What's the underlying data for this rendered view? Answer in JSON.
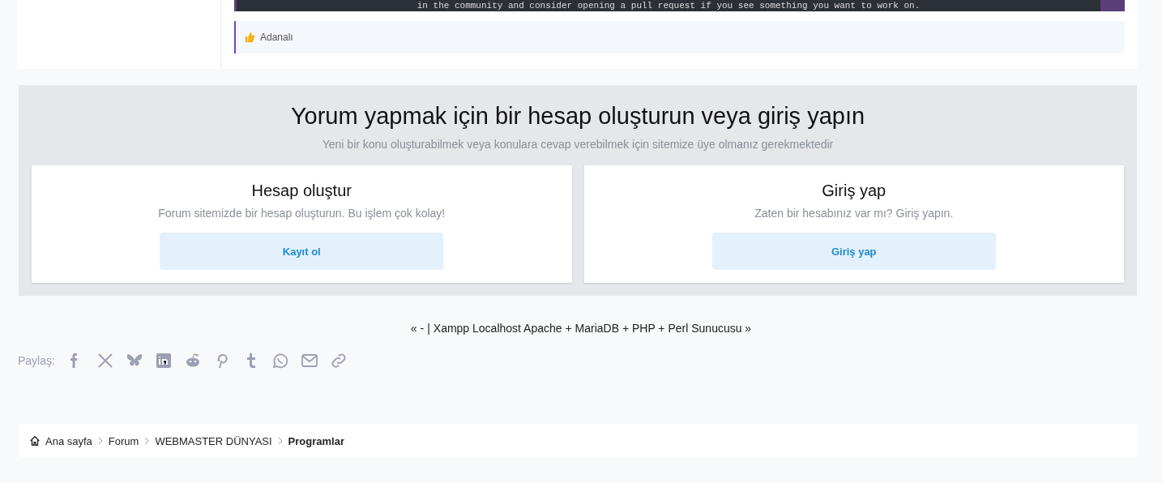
{
  "post": {
    "code_line": "in the community and consider opening a pull request if you see something you want to work on.",
    "reactions": {
      "users": "Adanalı"
    }
  },
  "auth_block": {
    "title": "Yorum yapmak için bir hesap oluşturun veya giriş yapın",
    "subtitle": "Yeni bir konu oluşturabilmek veya konulara cevap verebilmek için sitemize üye olmanız gerekmektedir",
    "cards": [
      {
        "title": "Hesap oluştur",
        "text": "Forum sitemizde bir hesap oluşturun. Bu işlem çok kolay!",
        "button": "Kayıt ol"
      },
      {
        "title": "Giriş yap",
        "text": "Zaten bir hesabınız var mı? Giriş yapın.",
        "button": "Giriş yap"
      }
    ]
  },
  "thread_nav": {
    "previous": "« -",
    "separator": "|",
    "next": "Xampp Localhost Apache + MariaDB + PHP + Perl Sunucusu »"
  },
  "share": {
    "label": "Paylaş:",
    "services": [
      {
        "kind": "facebook"
      },
      {
        "kind": "x"
      },
      {
        "kind": "bluesky"
      },
      {
        "kind": "linkedin"
      },
      {
        "kind": "reddit"
      },
      {
        "kind": "pinterest"
      },
      {
        "kind": "tumblr"
      },
      {
        "kind": "whatsapp"
      },
      {
        "kind": "email"
      },
      {
        "kind": "link"
      }
    ]
  },
  "breadcrumb": [
    {
      "label": "Ana sayfa",
      "current": false
    },
    {
      "label": "Forum",
      "current": false
    },
    {
      "label": "WEBMASTER DÜNYASI",
      "current": false
    },
    {
      "label": "Programlar",
      "current": true
    }
  ]
}
